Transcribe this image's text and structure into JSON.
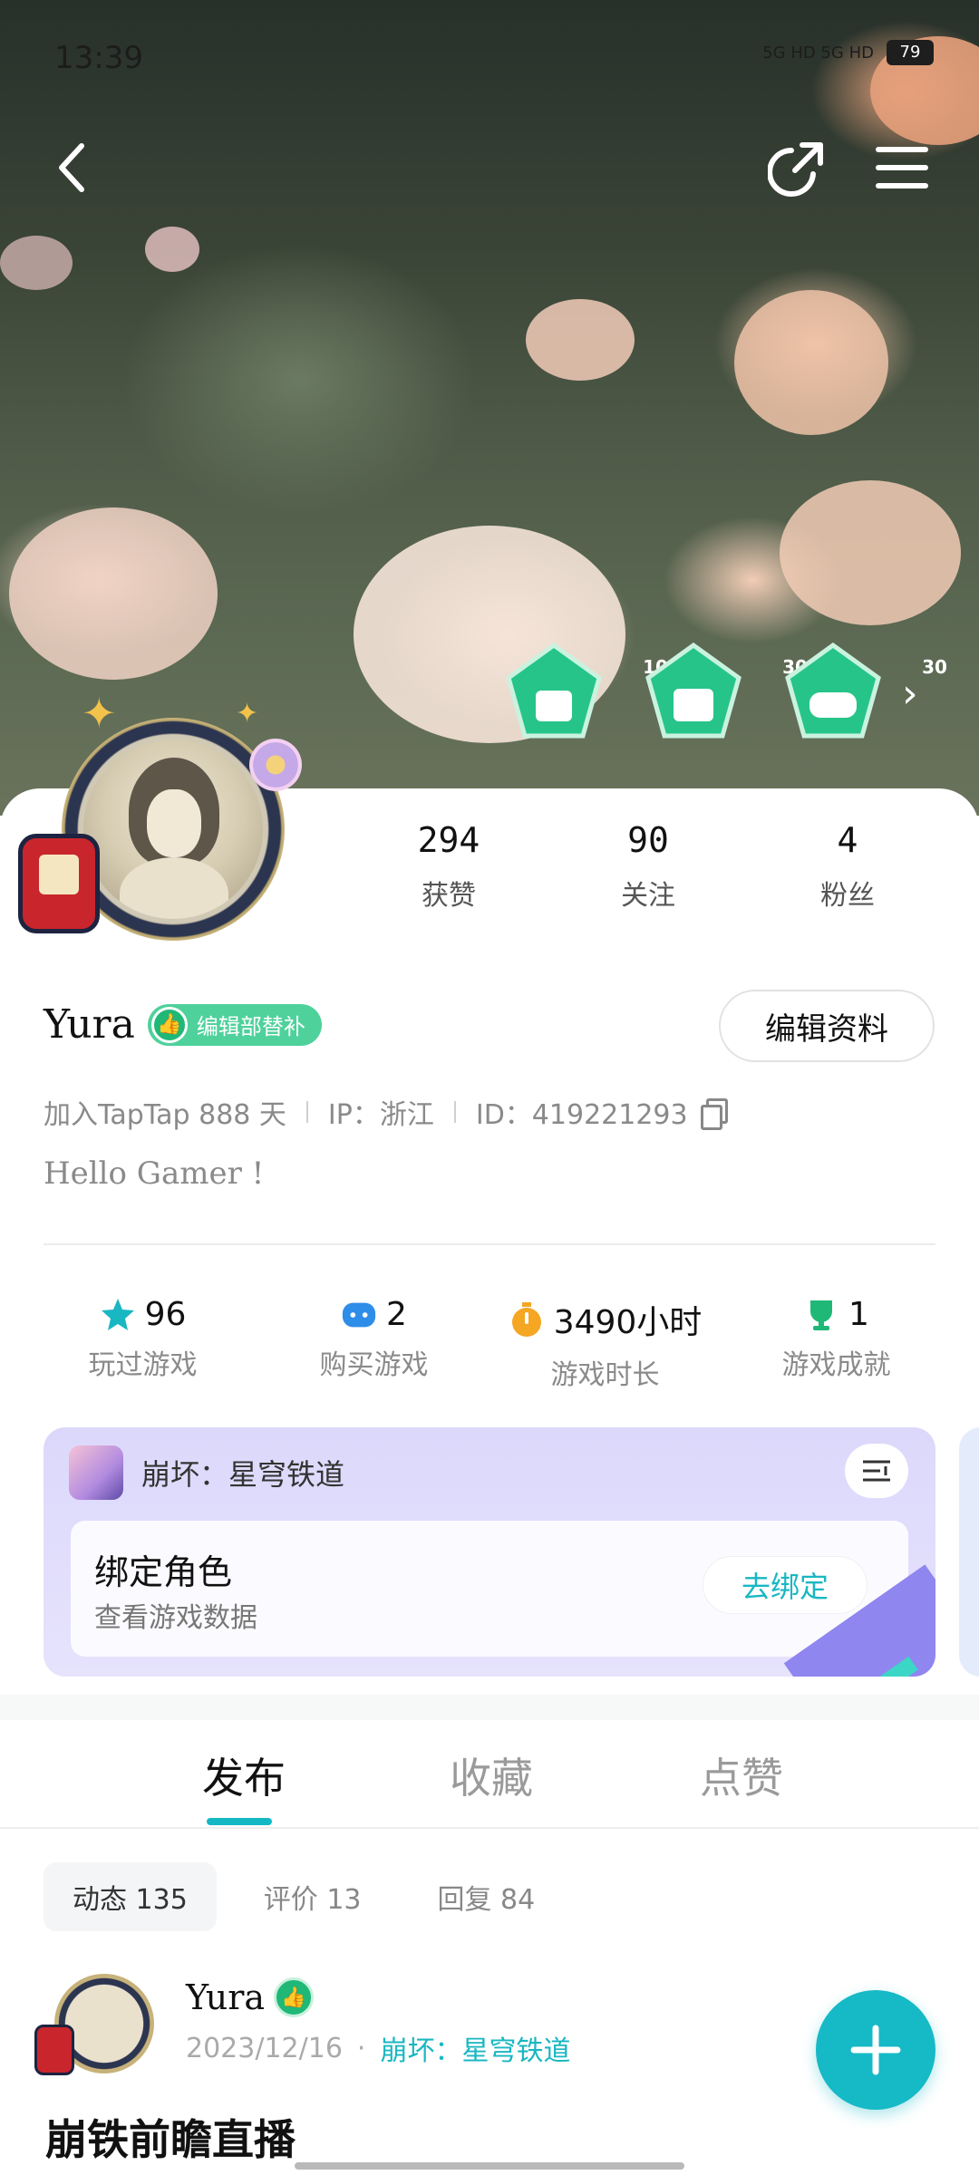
{
  "status_bar": {
    "time": "13:39",
    "network": "5G HD 5G HD",
    "battery": "79"
  },
  "header": {
    "back_icon": "chevron-left-icon",
    "share_icon": "share-icon",
    "menu_icon": "menu-icon"
  },
  "badges": [
    {
      "number": "10",
      "icon": "thumbs-up-icon",
      "color": "#27c48a"
    },
    {
      "number": "30",
      "icon": "calendar-icon",
      "color": "#27c48a"
    },
    {
      "number": "30",
      "icon": "gamepad-icon",
      "color": "#27c48a"
    }
  ],
  "profile": {
    "stats": [
      {
        "value": "294",
        "label": "获赞"
      },
      {
        "value": "90",
        "label": "关注"
      },
      {
        "value": "4",
        "label": "粉丝"
      }
    ],
    "username": "Yura",
    "title_badge": "编辑部替补",
    "edit_button": "编辑资料",
    "joined": "加入TapTap 888 天",
    "ip": "IP：浙江",
    "user_id": "ID：419221293",
    "bio": "Hello Gamer !"
  },
  "game_stats": [
    {
      "value": "96",
      "label": "玩过游戏",
      "icon": "star-icon",
      "color": "#19b7c2"
    },
    {
      "value": "2",
      "label": "购买游戏",
      "icon": "gamepad-icon",
      "color": "#2e8de8"
    },
    {
      "value": "3490小时",
      "label": "游戏时长",
      "icon": "timer-icon",
      "color": "#f5a623"
    },
    {
      "value": "1",
      "label": "游戏成就",
      "icon": "trophy-icon",
      "color": "#1fb877"
    }
  ],
  "game_card": {
    "game_name": "崩坏：星穹铁道",
    "bind_title": "绑定角色",
    "bind_subtitle": "查看游戏数据",
    "bind_button": "去绑定"
  },
  "tabs": [
    {
      "label": "发布",
      "active": true
    },
    {
      "label": "收藏",
      "active": false
    },
    {
      "label": "点赞",
      "active": false
    }
  ],
  "subtabs": [
    {
      "label": "动态 135",
      "active": true
    },
    {
      "label": "评价 13",
      "active": false
    },
    {
      "label": "回复 84",
      "active": false
    }
  ],
  "post": {
    "author": "Yura",
    "date": "2023/12/16",
    "separator": "·",
    "game": "崩坏：星穹铁道",
    "title": "崩铁前瞻直播"
  },
  "fab": {
    "icon": "plus-icon"
  },
  "colors": {
    "accent": "#16b9c6",
    "badge_green": "#27c48a",
    "card_purple": "#dcd8fb"
  }
}
